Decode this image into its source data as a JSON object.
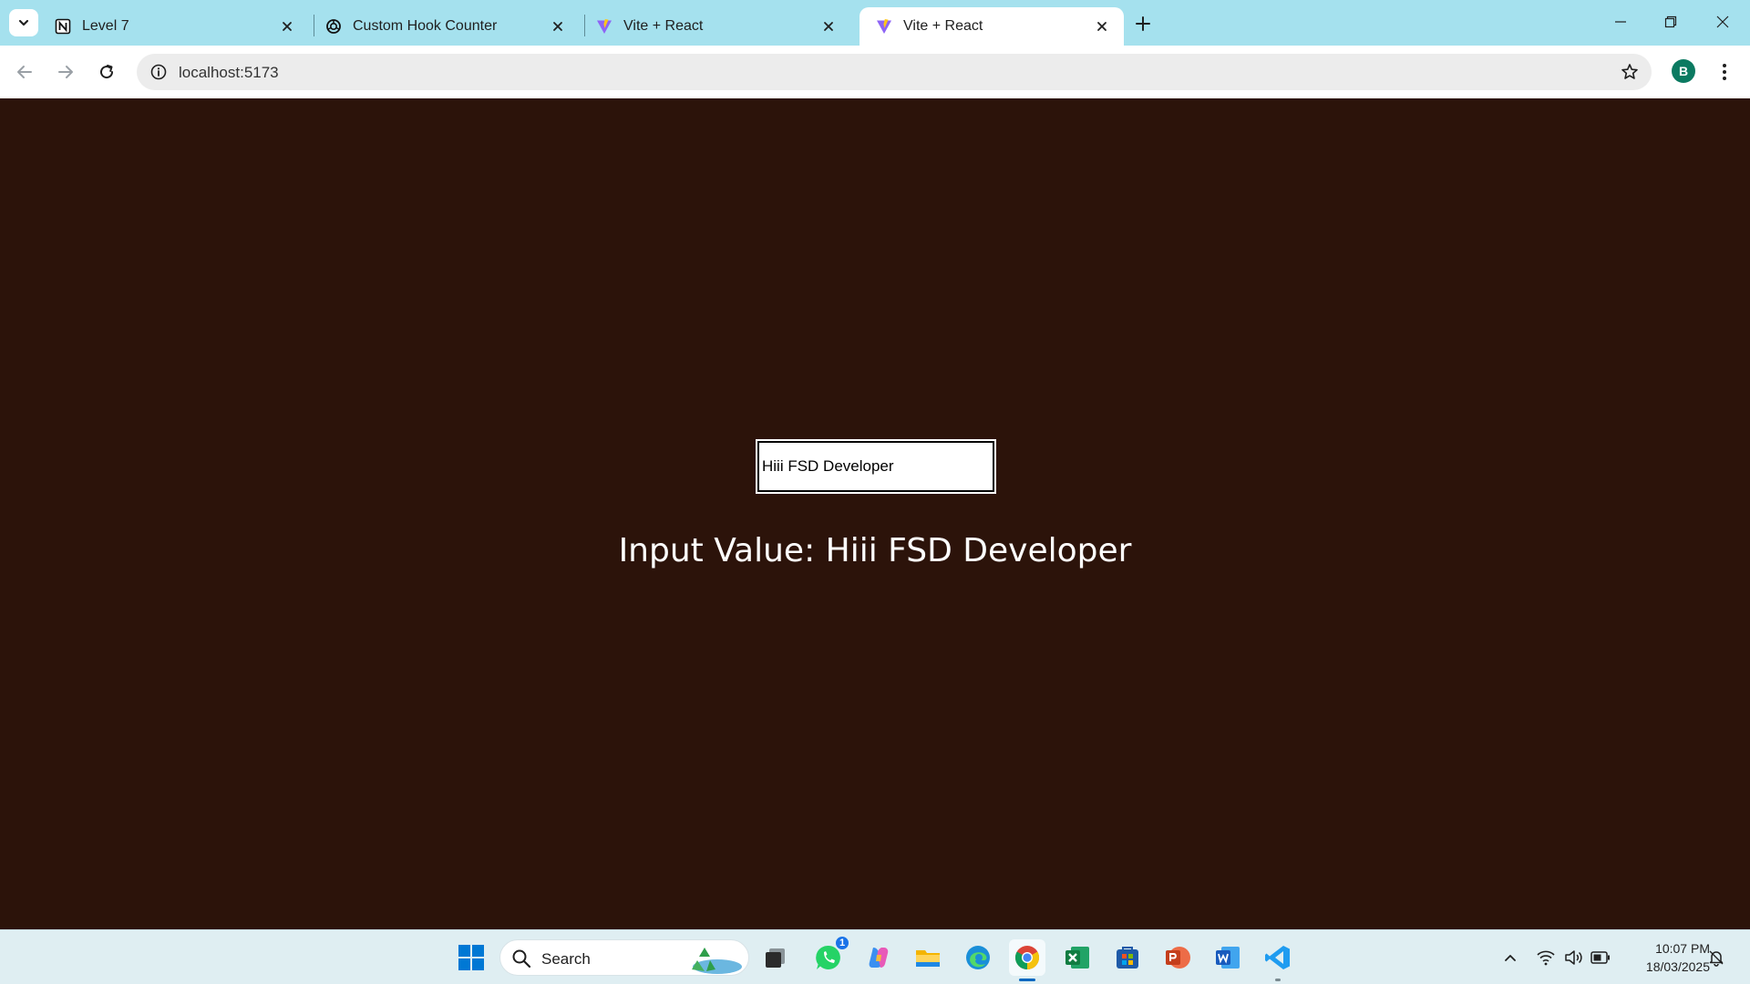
{
  "browser": {
    "tabs": [
      {
        "title": "Level 7",
        "icon": "notion-icon",
        "active": false
      },
      {
        "title": "Custom Hook Counter",
        "icon": "openai-icon",
        "active": false
      },
      {
        "title": "Vite + React",
        "icon": "vite-icon",
        "active": false
      },
      {
        "title": "Vite + React",
        "icon": "vite-icon",
        "active": true
      }
    ],
    "url": "localhost:5173",
    "profile_initial": "B",
    "accent": "#a5e1ee"
  },
  "page": {
    "input_value": "Hiii FSD Developer",
    "display_text": "Input Value: Hiii FSD Developer",
    "background": "#2c130a"
  },
  "taskbar": {
    "search_label": "Search",
    "whatsapp_badge": "1",
    "time": "10:07 PM",
    "date": "18/03/2025",
    "apps": [
      "windows-start-icon",
      "search-box",
      "task-view-icon",
      "whatsapp-icon",
      "copilot-icon",
      "file-explorer-icon",
      "edge-icon",
      "chrome-icon",
      "excel-icon",
      "store-icon",
      "powerpoint-icon",
      "word-icon",
      "vscode-icon"
    ]
  }
}
